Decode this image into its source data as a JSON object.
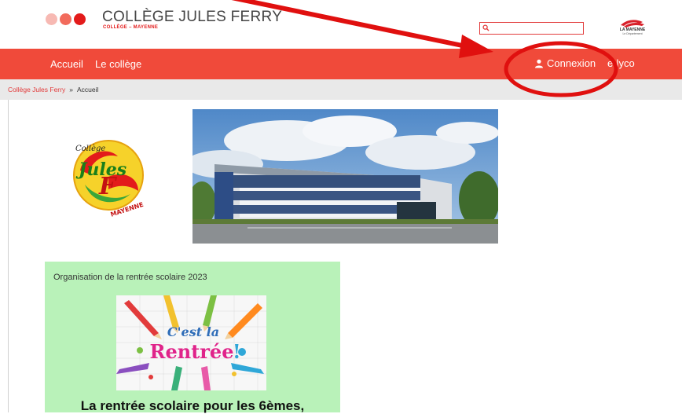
{
  "colors": {
    "brand_red": "#f04a3a",
    "dark_red": "#e31b1b",
    "annotation_red": "#e0100f",
    "breadcrumb_bg": "#e9e9e9",
    "card_bg": "#b9f2b9"
  },
  "header": {
    "title": "COLLÈGE JULES FERRY",
    "subtitle": "COLLÈGE – MAYENNE",
    "search_placeholder": "",
    "dept_logo_text": "LA MAYENNE",
    "dept_logo_sub": "Le Département"
  },
  "nav": {
    "items": [
      {
        "label": "Accueil"
      },
      {
        "label": "Le collège"
      }
    ],
    "connexion_label": "Connexion",
    "ent_label": "e-lyco"
  },
  "breadcrumb": {
    "items": [
      "Collège Jules Ferry",
      "Accueil"
    ],
    "separator": "»"
  },
  "images": {
    "school_logo_alt_icon": "school-logo",
    "hero_icon": "school-building-photo"
  },
  "card": {
    "title": "Organisation de la rentrée scolaire 2023",
    "image_text_1": "C'est la",
    "image_text_2": "Rentrée",
    "headline": "La rentrée scolaire pour les 6èmes,"
  },
  "logo": {
    "text_top": "Collège",
    "text_main": "Jules",
    "text_letter": "F",
    "text_bottom": "MAYENNE"
  }
}
